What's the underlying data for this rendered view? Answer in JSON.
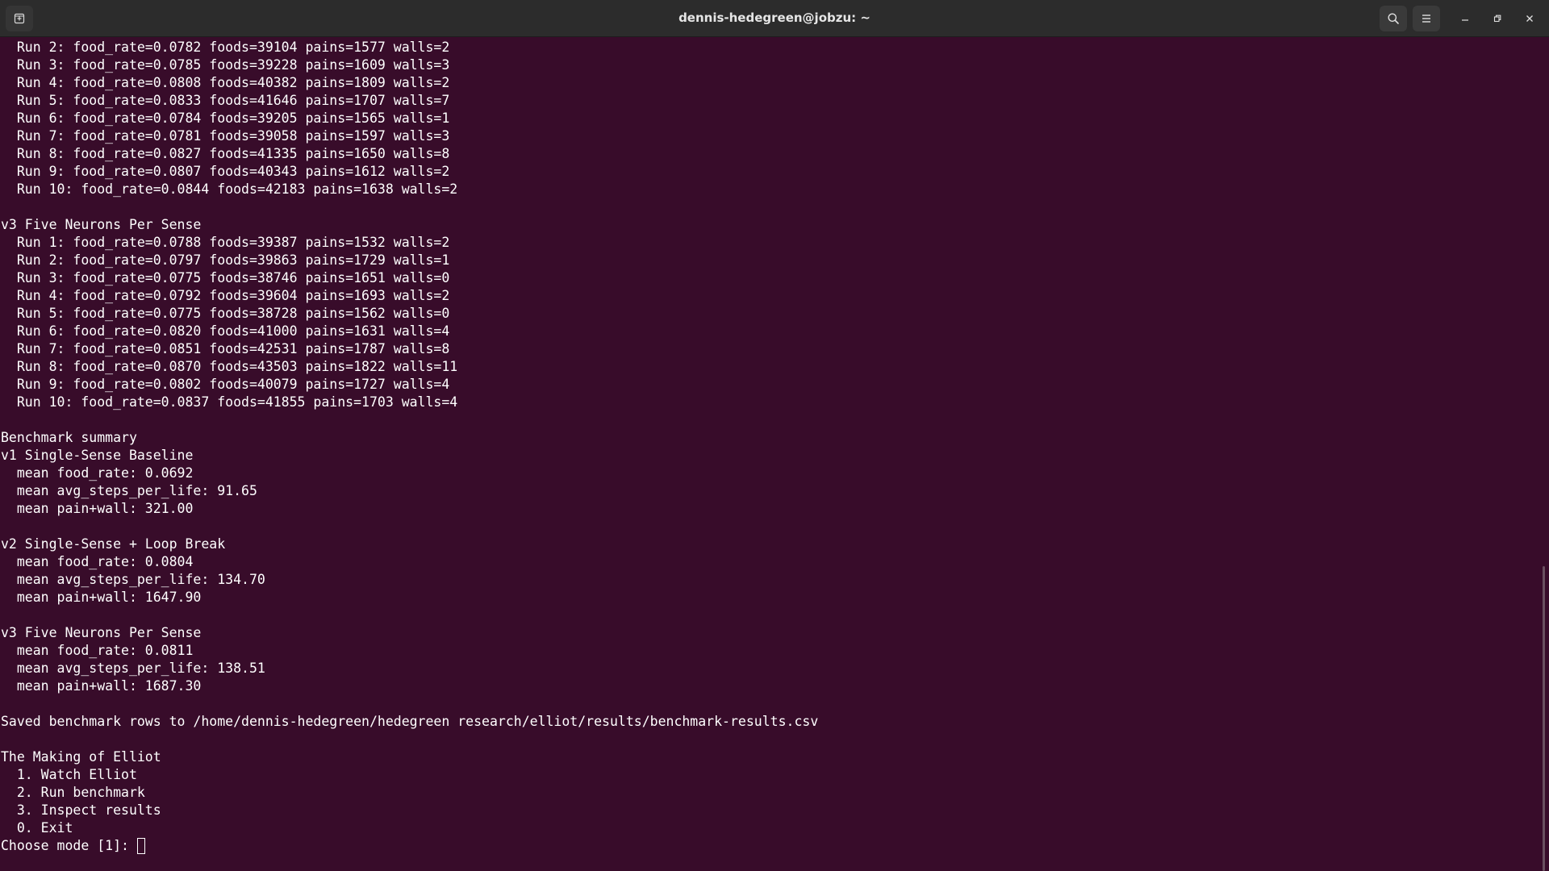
{
  "window": {
    "title": "dennis-hedegreen@jobzu: ~",
    "icons": {
      "new_tab": "new-tab-icon",
      "search": "search-icon",
      "menu": "hamburger-menu-icon",
      "minimize": "minimize-icon",
      "restore": "restore-icon",
      "close": "close-icon"
    }
  },
  "colors": {
    "terminal_bg": "#380c2a",
    "titlebar_bg": "#2c2c2c",
    "text": "#ffffff"
  },
  "terminal": {
    "lines": [
      "  Run 2: food_rate=0.0782 foods=39104 pains=1577 walls=2",
      "  Run 3: food_rate=0.0785 foods=39228 pains=1609 walls=3",
      "  Run 4: food_rate=0.0808 foods=40382 pains=1809 walls=2",
      "  Run 5: food_rate=0.0833 foods=41646 pains=1707 walls=7",
      "  Run 6: food_rate=0.0784 foods=39205 pains=1565 walls=1",
      "  Run 7: food_rate=0.0781 foods=39058 pains=1597 walls=3",
      "  Run 8: food_rate=0.0827 foods=41335 pains=1650 walls=8",
      "  Run 9: food_rate=0.0807 foods=40343 pains=1612 walls=2",
      "  Run 10: food_rate=0.0844 foods=42183 pains=1638 walls=2",
      "",
      "v3 Five Neurons Per Sense",
      "  Run 1: food_rate=0.0788 foods=39387 pains=1532 walls=2",
      "  Run 2: food_rate=0.0797 foods=39863 pains=1729 walls=1",
      "  Run 3: food_rate=0.0775 foods=38746 pains=1651 walls=0",
      "  Run 4: food_rate=0.0792 foods=39604 pains=1693 walls=2",
      "  Run 5: food_rate=0.0775 foods=38728 pains=1562 walls=0",
      "  Run 6: food_rate=0.0820 foods=41000 pains=1631 walls=4",
      "  Run 7: food_rate=0.0851 foods=42531 pains=1787 walls=8",
      "  Run 8: food_rate=0.0870 foods=43503 pains=1822 walls=11",
      "  Run 9: food_rate=0.0802 foods=40079 pains=1727 walls=4",
      "  Run 10: food_rate=0.0837 foods=41855 pains=1703 walls=4",
      "",
      "Benchmark summary",
      "v1 Single-Sense Baseline",
      "  mean food_rate: 0.0692",
      "  mean avg_steps_per_life: 91.65",
      "  mean pain+wall: 321.00",
      "",
      "v2 Single-Sense + Loop Break",
      "  mean food_rate: 0.0804",
      "  mean avg_steps_per_life: 134.70",
      "  mean pain+wall: 1647.90",
      "",
      "v3 Five Neurons Per Sense",
      "  mean food_rate: 0.0811",
      "  mean avg_steps_per_life: 138.51",
      "  mean pain+wall: 1687.30",
      "",
      "Saved benchmark rows to /home/dennis-hedegreen/hedegreen research/elliot/results/benchmark-results.csv",
      "",
      "The Making of Elliot",
      "  1. Watch Elliot",
      "  2. Run benchmark",
      "  3. Inspect results",
      "  0. Exit"
    ],
    "prompt": "Choose mode [1]: ",
    "input_value": ""
  }
}
